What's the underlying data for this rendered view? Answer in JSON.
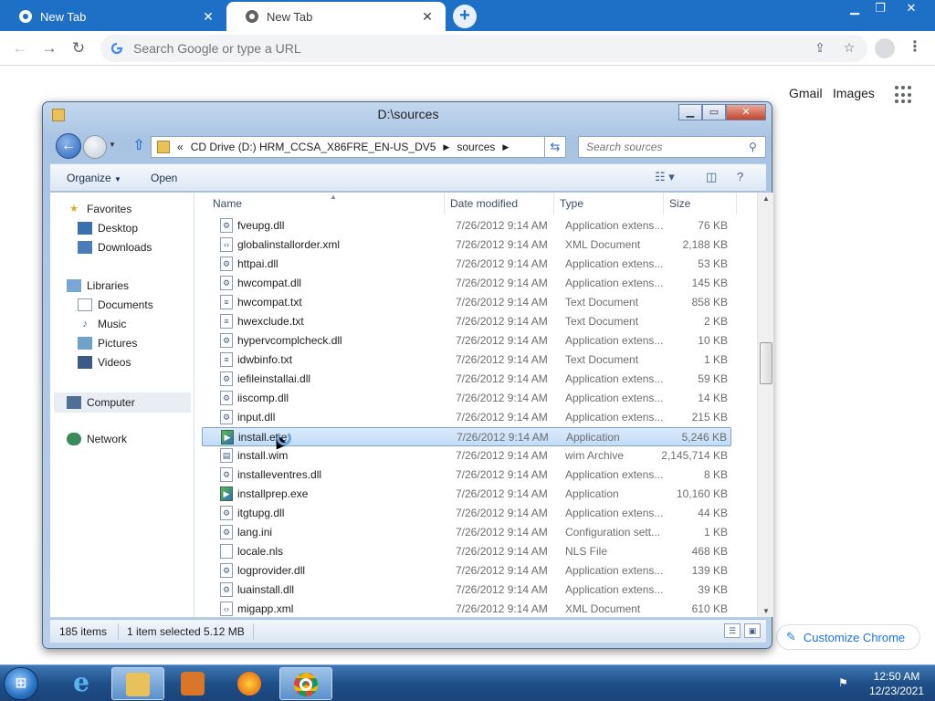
{
  "browser": {
    "tabs": [
      {
        "label": "New Tab",
        "active": false
      },
      {
        "label": "New Tab",
        "active": true
      }
    ],
    "omnibox_placeholder": "Search Google or type a URL",
    "ntp_links": {
      "gmail": "Gmail",
      "images": "Images"
    },
    "customize_label": "Customize Chrome",
    "colors": {
      "tabstrip": "#1e6fc6",
      "accent": "#1a73e8"
    }
  },
  "explorer": {
    "title": "D:\\sources",
    "address": {
      "prefix": "«",
      "crumbs": [
        "CD Drive (D:) HRM_CCSA_X86FRE_EN-US_DV5",
        "sources"
      ]
    },
    "search_placeholder": "Search sources",
    "commands": {
      "organize": "Organize",
      "open": "Open"
    },
    "nav": {
      "favorites": "Favorites",
      "desktop": "Desktop",
      "downloads": "Downloads",
      "libraries": "Libraries",
      "documents": "Documents",
      "music": "Music",
      "pictures": "Pictures",
      "videos": "Videos",
      "computer": "Computer",
      "network": "Network"
    },
    "columns": {
      "name": "Name",
      "date": "Date modified",
      "type": "Type",
      "size": "Size"
    },
    "files": [
      {
        "name": "fveupg.dll",
        "date": "7/26/2012 9:14 AM",
        "type": "Application extens...",
        "size": "76 KB",
        "kind": "dll"
      },
      {
        "name": "globalinstallorder.xml",
        "date": "7/26/2012 9:14 AM",
        "type": "XML Document",
        "size": "2,188 KB",
        "kind": "xml"
      },
      {
        "name": "httpai.dll",
        "date": "7/26/2012 9:14 AM",
        "type": "Application extens...",
        "size": "53 KB",
        "kind": "dll"
      },
      {
        "name": "hwcompat.dll",
        "date": "7/26/2012 9:14 AM",
        "type": "Application extens...",
        "size": "145 KB",
        "kind": "dll"
      },
      {
        "name": "hwcompat.txt",
        "date": "7/26/2012 9:14 AM",
        "type": "Text Document",
        "size": "858 KB",
        "kind": "txt"
      },
      {
        "name": "hwexclude.txt",
        "date": "7/26/2012 9:14 AM",
        "type": "Text Document",
        "size": "2 KB",
        "kind": "txt"
      },
      {
        "name": "hypervcomplcheck.dll",
        "date": "7/26/2012 9:14 AM",
        "type": "Application extens...",
        "size": "10 KB",
        "kind": "dll"
      },
      {
        "name": "idwbinfo.txt",
        "date": "7/26/2012 9:14 AM",
        "type": "Text Document",
        "size": "1 KB",
        "kind": "txt"
      },
      {
        "name": "iefileinstallai.dll",
        "date": "7/26/2012 9:14 AM",
        "type": "Application extens...",
        "size": "59 KB",
        "kind": "dll"
      },
      {
        "name": "iiscomp.dll",
        "date": "7/26/2012 9:14 AM",
        "type": "Application extens...",
        "size": "14 KB",
        "kind": "dll"
      },
      {
        "name": "input.dll",
        "date": "7/26/2012 9:14 AM",
        "type": "Application extens...",
        "size": "215 KB",
        "kind": "dll"
      },
      {
        "name": "install.exe",
        "date": "7/26/2012 9:14 AM",
        "type": "Application",
        "size": "5,246 KB",
        "kind": "exe",
        "selected": true
      },
      {
        "name": "install.wim",
        "date": "7/26/2012 9:14 AM",
        "type": "wim Archive",
        "size": "2,145,714 KB",
        "kind": "wim"
      },
      {
        "name": "installeventres.dll",
        "date": "7/26/2012 9:14 AM",
        "type": "Application extens...",
        "size": "8 KB",
        "kind": "dll"
      },
      {
        "name": "installprep.exe",
        "date": "7/26/2012 9:14 AM",
        "type": "Application",
        "size": "10,160 KB",
        "kind": "exe"
      },
      {
        "name": "itgtupg.dll",
        "date": "7/26/2012 9:14 AM",
        "type": "Application extens...",
        "size": "44 KB",
        "kind": "dll"
      },
      {
        "name": "lang.ini",
        "date": "7/26/2012 9:14 AM",
        "type": "Configuration sett...",
        "size": "1 KB",
        "kind": "ini"
      },
      {
        "name": "locale.nls",
        "date": "7/26/2012 9:14 AM",
        "type": "NLS File",
        "size": "468 KB",
        "kind": "nls"
      },
      {
        "name": "logprovider.dll",
        "date": "7/26/2012 9:14 AM",
        "type": "Application extens...",
        "size": "139 KB",
        "kind": "dll"
      },
      {
        "name": "luainstall.dll",
        "date": "7/26/2012 9:14 AM",
        "type": "Application extens...",
        "size": "39 KB",
        "kind": "dll"
      },
      {
        "name": "migapp.xml",
        "date": "7/26/2012 9:14 AM",
        "type": "XML Document",
        "size": "610 KB",
        "kind": "xml"
      }
    ],
    "status": {
      "count": "185 items",
      "selection": "1 item selected  5.12 MB"
    }
  },
  "taskbar": {
    "apps": [
      "start-orb",
      "internet-explorer-icon",
      "windows-explorer-icon",
      "media-player-icon",
      "firefox-icon",
      "chrome-icon"
    ],
    "time": "12:50 AM",
    "date": "12/23/2021"
  }
}
